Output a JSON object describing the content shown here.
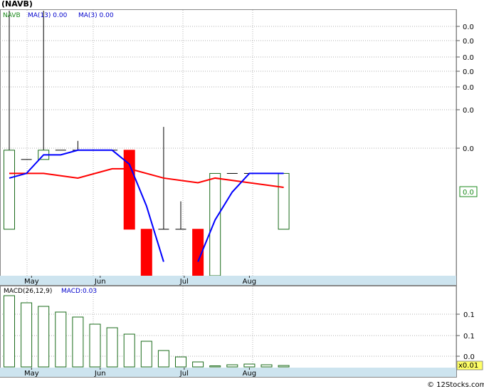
{
  "ticker_title": "(NAVB)",
  "watermark": "© 12Stocks.com",
  "colors": {
    "up_candle": "#1a6b1a",
    "down_candle": "#ff0000",
    "ma13": "#ff0000",
    "ma3": "#0000ff",
    "axis_band": "#cde4ef",
    "grid": "#999999",
    "macd_label": "#0000cc",
    "last_price_box": "#1a8a1a",
    "scale_box": "#ffff66"
  },
  "chart_data": [
    {
      "type": "candlestick",
      "legend": [
        {
          "text": "NAVB",
          "color": "#1a8a1a"
        },
        {
          "text": "MA(13)  0.00",
          "color": "#0000cc"
        },
        {
          "text": "MA(3)  0.00",
          "color": "#0000cc"
        }
      ],
      "x_tick_labels": [
        {
          "label": "May",
          "index": 1.3
        },
        {
          "label": "Jun",
          "index": 5.3
        },
        {
          "label": "Jul",
          "index": 10.2
        },
        {
          "label": "Aug",
          "index": 14.0
        }
      ],
      "y_tick_labels": [
        "0.0",
        "0.0",
        "0.0",
        "0.0",
        "0.0",
        "0.0",
        "0.0"
      ],
      "last_price_label": "0.0",
      "candles": [
        {
          "open": 0.0058,
          "high": 0.0105,
          "low": 0.0058,
          "close": 0.0075,
          "dir": "up"
        },
        {
          "open": 0.0073,
          "high": 0.0073,
          "low": 0.0073,
          "close": 0.0073,
          "dir": "flat"
        },
        {
          "open": 0.0073,
          "high": 0.0105,
          "low": 0.0073,
          "close": 0.0075,
          "dir": "up"
        },
        {
          "open": 0.0075,
          "high": 0.0075,
          "low": 0.0075,
          "close": 0.0075,
          "dir": "flat"
        },
        {
          "open": 0.0075,
          "high": 0.0077,
          "low": 0.0075,
          "close": 0.0075,
          "dir": "flat"
        },
        {
          "open": 0.0075,
          "high": 0.0075,
          "low": 0.0075,
          "close": 0.0075,
          "dir": "flat"
        },
        {
          "open": 0.0075,
          "high": 0.0075,
          "low": 0.0075,
          "close": 0.0075,
          "dir": "flat"
        },
        {
          "open": 0.0075,
          "high": 0.0075,
          "low": 0.0058,
          "close": 0.0058,
          "dir": "down"
        },
        {
          "open": 0.0058,
          "high": 0.0058,
          "low": 0.0048,
          "close": 0.0048,
          "dir": "down"
        },
        {
          "open": 0.0058,
          "high": 0.008,
          "low": 0.0058,
          "close": 0.0058,
          "dir": "flat"
        },
        {
          "open": 0.0058,
          "high": 0.0064,
          "low": 0.0058,
          "close": 0.0058,
          "dir": "flat"
        },
        {
          "open": 0.0058,
          "high": 0.0058,
          "low": 0.0048,
          "close": 0.0048,
          "dir": "down"
        },
        {
          "open": 0.0048,
          "high": 0.007,
          "low": 0.0048,
          "close": 0.007,
          "dir": "up"
        },
        {
          "open": 0.007,
          "high": 0.007,
          "low": 0.007,
          "close": 0.007,
          "dir": "flat"
        },
        {
          "open": 0.007,
          "high": 0.007,
          "low": 0.007,
          "close": 0.007,
          "dir": "flat"
        },
        {
          "open": 0.007,
          "high": 0.007,
          "low": 0.007,
          "close": 0.007,
          "dir": "flat"
        },
        {
          "open": 0.0058,
          "high": 0.007,
          "low": 0.0058,
          "close": 0.007,
          "dir": "up"
        }
      ],
      "ma13": [
        {
          "i": 0,
          "v": 0.007
        },
        {
          "i": 2,
          "v": 0.007
        },
        {
          "i": 4,
          "v": 0.0069
        },
        {
          "i": 6,
          "v": 0.0071
        },
        {
          "i": 7,
          "v": 0.0071
        },
        {
          "i": 9,
          "v": 0.0069
        },
        {
          "i": 11,
          "v": 0.0068
        },
        {
          "i": 12,
          "v": 0.0069
        },
        {
          "i": 14,
          "v": 0.0068
        },
        {
          "i": 16,
          "v": 0.0067
        }
      ],
      "ma3": [
        {
          "i": 0,
          "v": 0.0069
        },
        {
          "i": 1,
          "v": 0.007
        },
        {
          "i": 2,
          "v": 0.0074
        },
        {
          "i": 3,
          "v": 0.0074
        },
        {
          "i": 4,
          "v": 0.0075
        },
        {
          "i": 5,
          "v": 0.0075
        },
        {
          "i": 6,
          "v": 0.0075
        },
        {
          "i": 7,
          "v": 0.0072
        },
        {
          "i": 8,
          "v": 0.0063
        },
        {
          "i": 9,
          "v": 0.0051
        },
        {
          "i": 10,
          "v": 0.0051
        },
        {
          "i": 11,
          "v": 0.0051
        },
        {
          "i": 12,
          "v": 0.006
        },
        {
          "i": 13,
          "v": 0.0066
        },
        {
          "i": 14,
          "v": 0.007
        },
        {
          "i": 15,
          "v": 0.007
        },
        {
          "i": 16,
          "v": 0.007
        }
      ]
    },
    {
      "type": "bar",
      "legend": [
        {
          "text": "MACD(26,12,9)",
          "color": "#000000"
        },
        {
          "text": "MACD:0.03",
          "color": "#0000cc"
        }
      ],
      "x_tick_labels": [
        {
          "label": "May",
          "index": 1.3
        },
        {
          "label": "Jun",
          "index": 5.3
        },
        {
          "label": "Jul",
          "index": 10.2
        },
        {
          "label": "Aug",
          "index": 14.0
        }
      ],
      "y_tick_labels": [
        "0.1",
        "0.1",
        "0.0"
      ],
      "scale_label": "x0.01",
      "values": [
        0.1,
        0.09,
        0.085,
        0.077,
        0.07,
        0.06,
        0.055,
        0.046,
        0.036,
        0.023,
        0.014,
        0.007,
        0.0,
        0.003,
        0.004,
        0.003,
        0.002
      ]
    }
  ]
}
